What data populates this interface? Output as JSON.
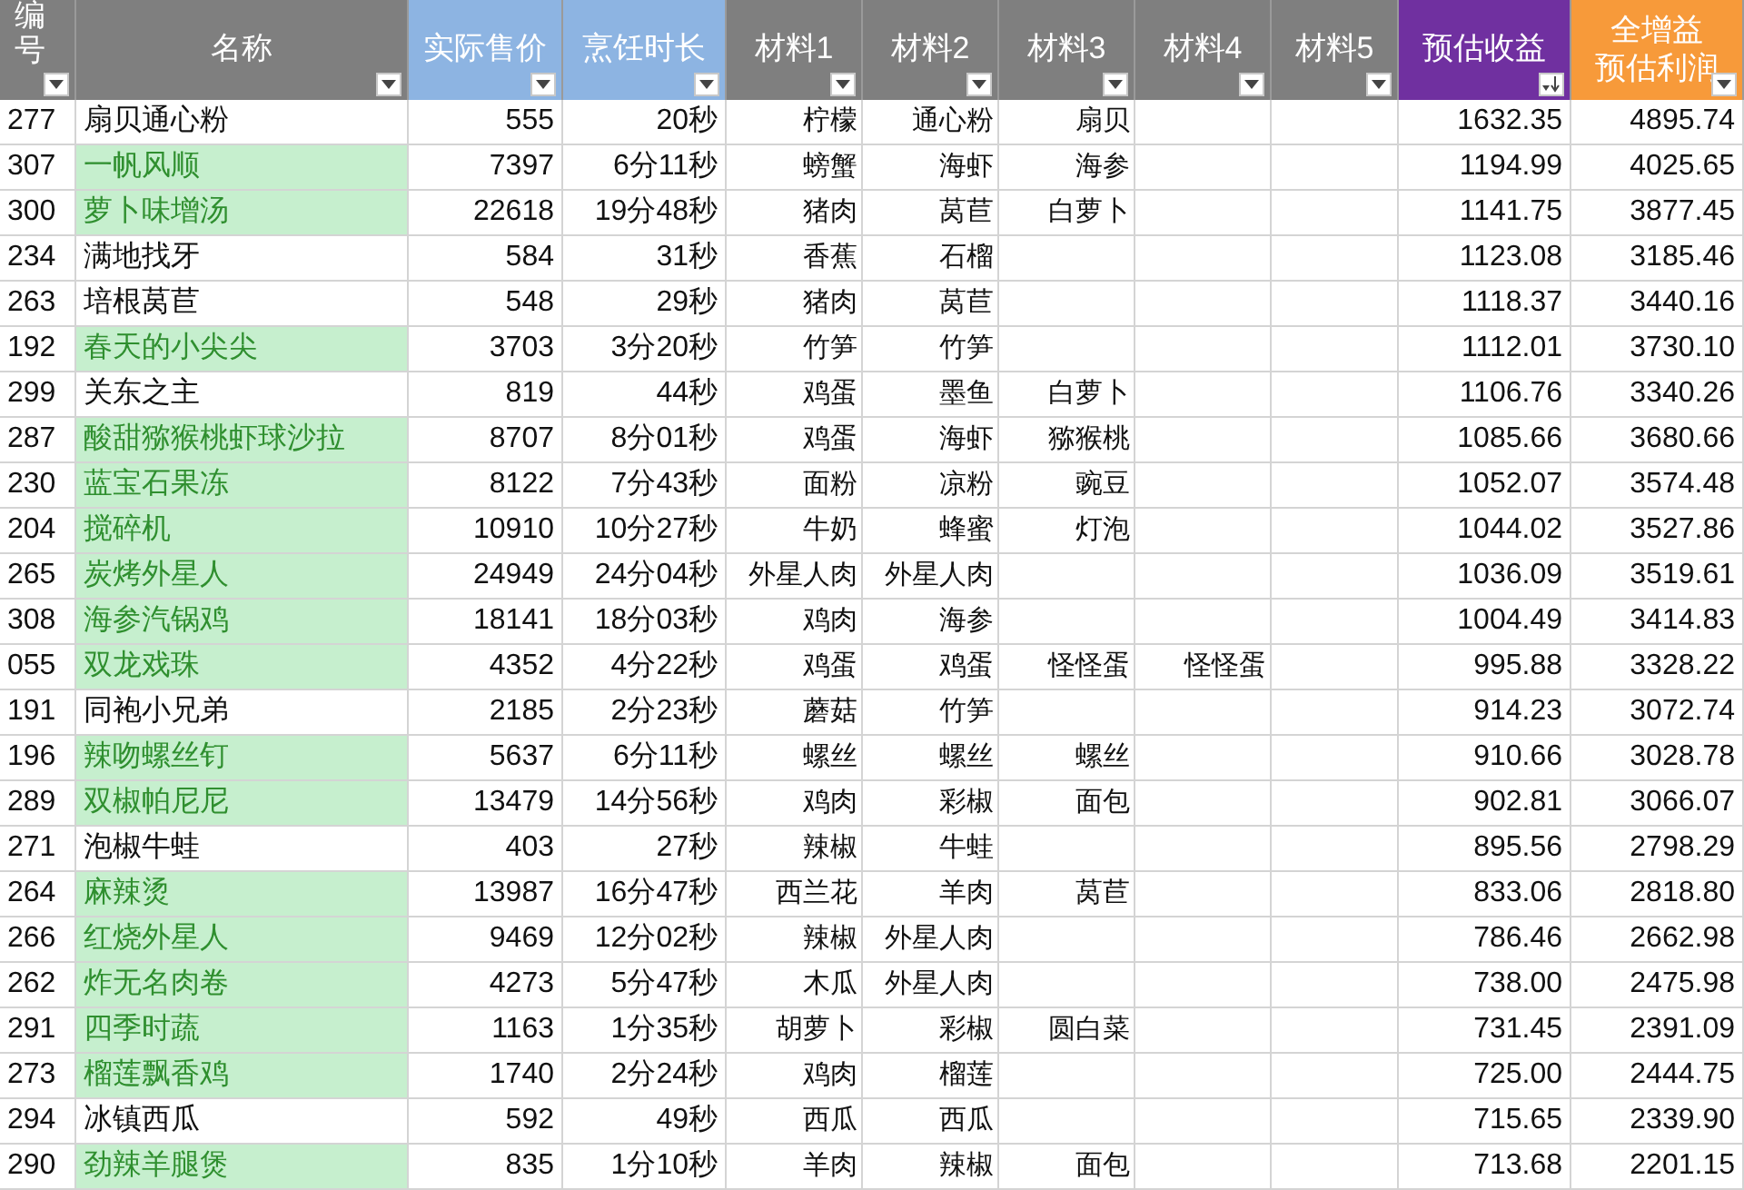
{
  "table": {
    "columns": [
      {
        "lines": [
          "编号"
        ],
        "color": "#7f7f7f",
        "sorted": false
      },
      {
        "lines": [
          "名称"
        ],
        "color": "#7f7f7f",
        "sorted": false
      },
      {
        "lines": [
          "实际售价"
        ],
        "color": "#8db4e2",
        "sorted": false
      },
      {
        "lines": [
          "烹饪时长"
        ],
        "color": "#8db4e2",
        "sorted": false
      },
      {
        "lines": [
          "材料1"
        ],
        "color": "#7f7f7f",
        "sorted": false
      },
      {
        "lines": [
          "材料2"
        ],
        "color": "#7f7f7f",
        "sorted": false
      },
      {
        "lines": [
          "材料3"
        ],
        "color": "#7f7f7f",
        "sorted": false
      },
      {
        "lines": [
          "材料4"
        ],
        "color": "#7f7f7f",
        "sorted": false
      },
      {
        "lines": [
          "材料5"
        ],
        "color": "#7f7f7f",
        "sorted": false
      },
      {
        "lines": [
          "预估收益"
        ],
        "color": "#7030a0",
        "sorted": true
      },
      {
        "lines": [
          "全增益",
          "预估利润"
        ],
        "color": "#f79a3a",
        "sorted": false
      }
    ],
    "rows": [
      {
        "id": "277",
        "name": "扇贝通心粉",
        "highlighted": false,
        "price": "555",
        "time": "20秒",
        "materials": [
          "柠檬",
          "通心粉",
          "扇贝"
        ],
        "income": "1632.35",
        "profit": "4895.74"
      },
      {
        "id": "307",
        "name": "一帆风顺",
        "highlighted": true,
        "price": "7397",
        "time": "6分11秒",
        "materials": [
          "螃蟹",
          "海虾",
          "海参"
        ],
        "income": "1194.99",
        "profit": "4025.65"
      },
      {
        "id": "300",
        "name": "萝卜味增汤",
        "highlighted": true,
        "price": "22618",
        "time": "19分48秒",
        "materials": [
          "猪肉",
          "莴苣",
          "白萝卜"
        ],
        "income": "1141.75",
        "profit": "3877.45"
      },
      {
        "id": "234",
        "name": "满地找牙",
        "highlighted": false,
        "price": "584",
        "time": "31秒",
        "materials": [
          "香蕉",
          "石榴"
        ],
        "income": "1123.08",
        "profit": "3185.46"
      },
      {
        "id": "263",
        "name": "培根莴苣",
        "highlighted": false,
        "price": "548",
        "time": "29秒",
        "materials": [
          "猪肉",
          "莴苣"
        ],
        "income": "1118.37",
        "profit": "3440.16"
      },
      {
        "id": "192",
        "name": "春天的小尖尖",
        "highlighted": true,
        "price": "3703",
        "time": "3分20秒",
        "materials": [
          "竹笋",
          "竹笋"
        ],
        "income": "1112.01",
        "profit": "3730.10"
      },
      {
        "id": "299",
        "name": "关东之主",
        "highlighted": false,
        "price": "819",
        "time": "44秒",
        "materials": [
          "鸡蛋",
          "墨鱼",
          "白萝卜"
        ],
        "income": "1106.76",
        "profit": "3340.26"
      },
      {
        "id": "287",
        "name": "酸甜猕猴桃虾球沙拉",
        "highlighted": true,
        "price": "8707",
        "time": "8分01秒",
        "materials": [
          "鸡蛋",
          "海虾",
          "猕猴桃"
        ],
        "income": "1085.66",
        "profit": "3680.66"
      },
      {
        "id": "230",
        "name": "蓝宝石果冻",
        "highlighted": true,
        "price": "8122",
        "time": "7分43秒",
        "materials": [
          "面粉",
          "凉粉",
          "豌豆"
        ],
        "income": "1052.07",
        "profit": "3574.48"
      },
      {
        "id": "204",
        "name": "搅碎机",
        "highlighted": true,
        "price": "10910",
        "time": "10分27秒",
        "materials": [
          "牛奶",
          "蜂蜜",
          "灯泡"
        ],
        "income": "1044.02",
        "profit": "3527.86"
      },
      {
        "id": "265",
        "name": "炭烤外星人",
        "highlighted": true,
        "price": "24949",
        "time": "24分04秒",
        "materials": [
          "外星人肉",
          "外星人肉"
        ],
        "income": "1036.09",
        "profit": "3519.61"
      },
      {
        "id": "308",
        "name": "海参汽锅鸡",
        "highlighted": true,
        "price": "18141",
        "time": "18分03秒",
        "materials": [
          "鸡肉",
          "海参"
        ],
        "income": "1004.49",
        "profit": "3414.83"
      },
      {
        "id": "055",
        "name": "双龙戏珠",
        "highlighted": true,
        "price": "4352",
        "time": "4分22秒",
        "materials": [
          "鸡蛋",
          "鸡蛋",
          "怪怪蛋",
          "怪怪蛋"
        ],
        "income": "995.88",
        "profit": "3328.22"
      },
      {
        "id": "191",
        "name": "同袍小兄弟",
        "highlighted": false,
        "price": "2185",
        "time": "2分23秒",
        "materials": [
          "蘑菇",
          "竹笋"
        ],
        "income": "914.23",
        "profit": "3072.74"
      },
      {
        "id": "196",
        "name": "辣吻螺丝钉",
        "highlighted": true,
        "price": "5637",
        "time": "6分11秒",
        "materials": [
          "螺丝",
          "螺丝",
          "螺丝"
        ],
        "income": "910.66",
        "profit": "3028.78"
      },
      {
        "id": "289",
        "name": "双椒帕尼尼",
        "highlighted": true,
        "price": "13479",
        "time": "14分56秒",
        "materials": [
          "鸡肉",
          "彩椒",
          "面包"
        ],
        "income": "902.81",
        "profit": "3066.07"
      },
      {
        "id": "271",
        "name": "泡椒牛蛙",
        "highlighted": false,
        "price": "403",
        "time": "27秒",
        "materials": [
          "辣椒",
          "牛蛙"
        ],
        "income": "895.56",
        "profit": "2798.29"
      },
      {
        "id": "264",
        "name": "麻辣烫",
        "highlighted": true,
        "price": "13987",
        "time": "16分47秒",
        "materials": [
          "西兰花",
          "羊肉",
          "莴苣"
        ],
        "income": "833.06",
        "profit": "2818.80"
      },
      {
        "id": "266",
        "name": "红烧外星人",
        "highlighted": true,
        "price": "9469",
        "time": "12分02秒",
        "materials": [
          "辣椒",
          "外星人肉"
        ],
        "income": "786.46",
        "profit": "2662.98"
      },
      {
        "id": "262",
        "name": "炸无名肉卷",
        "highlighted": true,
        "price": "4273",
        "time": "5分47秒",
        "materials": [
          "木瓜",
          "外星人肉"
        ],
        "income": "738.00",
        "profit": "2475.98"
      },
      {
        "id": "291",
        "name": "四季时蔬",
        "highlighted": true,
        "price": "1163",
        "time": "1分35秒",
        "materials": [
          "胡萝卜",
          "彩椒",
          "圆白菜"
        ],
        "income": "731.45",
        "profit": "2391.09"
      },
      {
        "id": "273",
        "name": "榴莲飘香鸡",
        "highlighted": true,
        "price": "1740",
        "time": "2分24秒",
        "materials": [
          "鸡肉",
          "榴莲"
        ],
        "income": "725.00",
        "profit": "2444.75"
      },
      {
        "id": "294",
        "name": "冰镇西瓜",
        "highlighted": false,
        "price": "592",
        "time": "49秒",
        "materials": [
          "西瓜",
          "西瓜"
        ],
        "income": "715.65",
        "profit": "2339.90"
      },
      {
        "id": "290",
        "name": "劲辣羊腿煲",
        "highlighted": true,
        "price": "835",
        "time": "1分10秒",
        "materials": [
          "羊肉",
          "辣椒",
          "面包"
        ],
        "income": "713.68",
        "profit": "2201.15"
      }
    ]
  }
}
